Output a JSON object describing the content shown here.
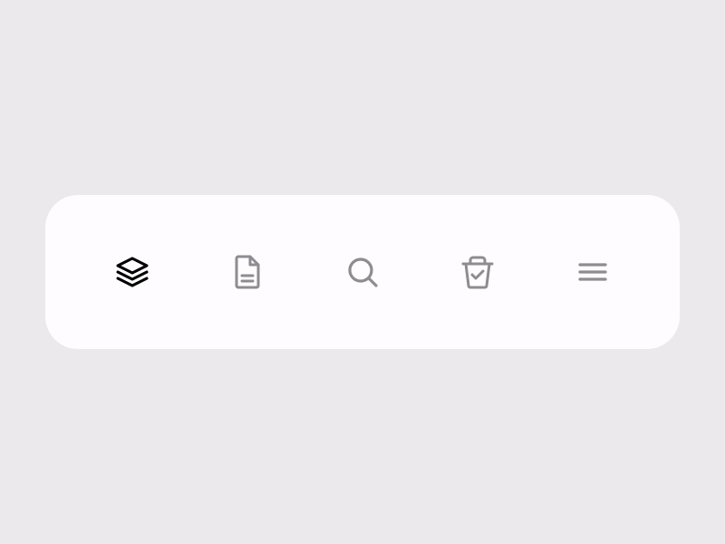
{
  "theme": {
    "background": "#ebe9eb",
    "bar_background": "#fefcfe",
    "active_color": "#000000",
    "inactive_color": "#8e8c92"
  },
  "tab_bar": {
    "active_index": 0,
    "items": [
      {
        "icon": "layers-icon",
        "active": true
      },
      {
        "icon": "document-icon",
        "active": false
      },
      {
        "icon": "search-icon",
        "active": false
      },
      {
        "icon": "basket-check-icon",
        "active": false
      },
      {
        "icon": "menu-icon",
        "active": false
      }
    ]
  }
}
